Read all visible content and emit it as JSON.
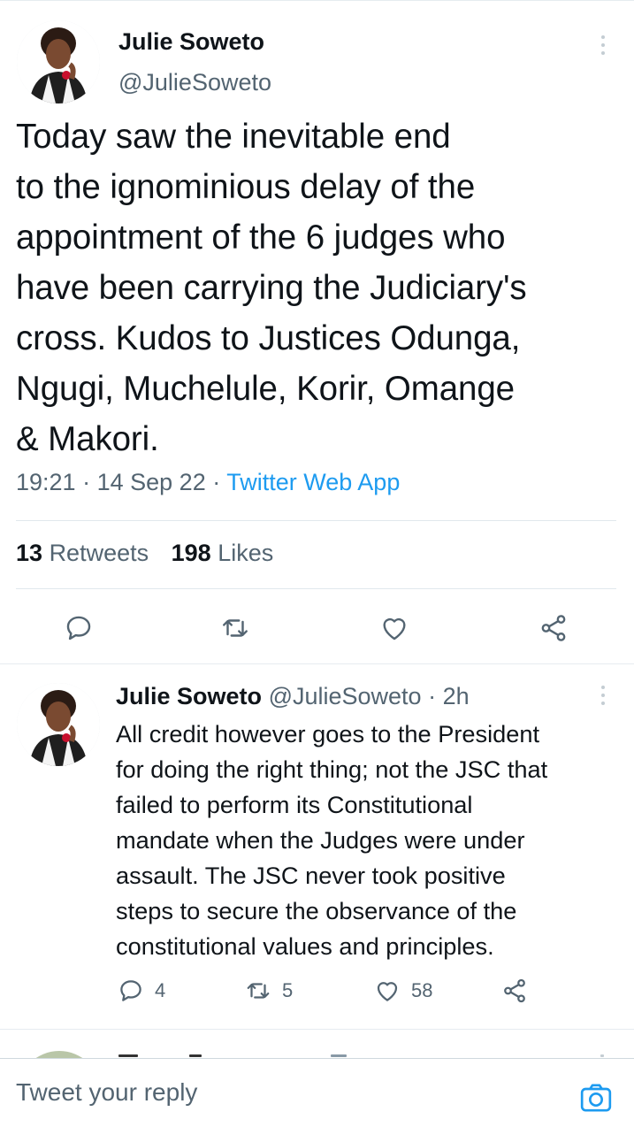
{
  "main_tweet": {
    "author_name": "Julie Soweto",
    "author_handle": "@JulieSoweto",
    "text": "Today saw the inevitable end\nto the ignominious delay of the\nappointment of the 6 judges who\nhave been carrying the Judiciary's\ncross. Kudos to Justices Odunga,\nNgugi, Muchelule, Korir, Omange\n& Makori.",
    "time": "19:21",
    "separator": "·",
    "date": "14 Sep 22",
    "source_app": "Twitter Web App",
    "retweets_count": "13",
    "retweets_label": "Retweets",
    "likes_count": "198",
    "likes_label": "Likes",
    "actions": [
      "reply-icon",
      "retweet-icon",
      "like-icon",
      "share-icon"
    ]
  },
  "reply_tweet": {
    "author_name": "Julie Soweto",
    "author_handle": "@JulieSoweto",
    "separator": "·",
    "age": "2h",
    "text": "All credit however goes to the President\nfor doing the right thing; not the JSC that\nfailed to perform its Constitutional\nmandate when the Judges were under\nassault. The JSC never took positive\nsteps to secure the observance of the\nconstitutional values and principles.",
    "reply_count": "4",
    "retweet_count": "5",
    "like_count": "58"
  },
  "composer": {
    "placeholder": "Tweet your reply",
    "camera_icon": "camera-icon"
  },
  "colors": {
    "text": "#0f1419",
    "secondary": "#536471",
    "accent": "#1d9bf0",
    "divider": "#e1e8ed"
  }
}
